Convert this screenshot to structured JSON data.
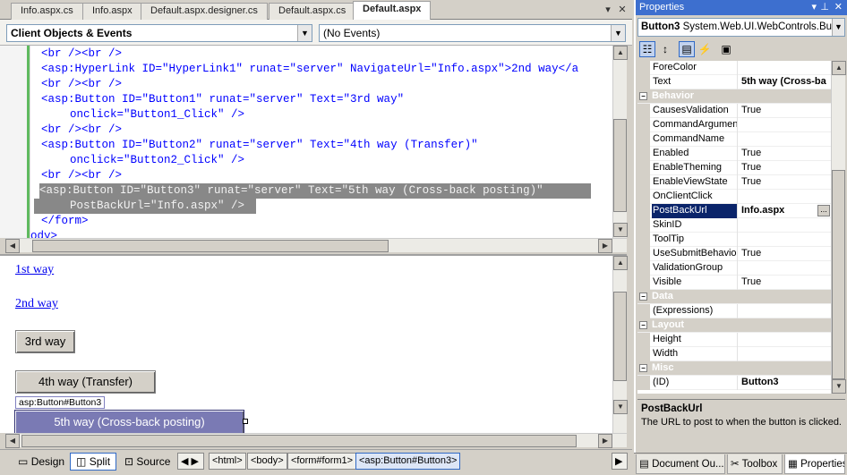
{
  "tabs": [
    {
      "label": "Info.aspx.cs"
    },
    {
      "label": "Info.aspx"
    },
    {
      "label": "Default.aspx.designer.cs"
    },
    {
      "label": "Default.aspx.cs"
    },
    {
      "label": "Default.aspx",
      "active": true
    }
  ],
  "dropdowns": {
    "objects": "Client Objects & Events",
    "events": "(No Events)"
  },
  "code": {
    "l1": "<br /><br />",
    "l2": "<asp:HyperLink ID=\"HyperLink1\" runat=\"server\" NavigateUrl=\"Info.aspx\">2nd way</a",
    "l3": "<br /><br />",
    "l4": "<asp:Button ID=\"Button1\" runat=\"server\" Text=\"3rd way\"",
    "l5": "onclick=\"Button1_Click\" />",
    "l6": "<br /><br />",
    "l7": "<asp:Button ID=\"Button2\" runat=\"server\" Text=\"4th way (Transfer)\"",
    "l8": "onclick=\"Button2_Click\" />",
    "l9": "<br /><br />",
    "l10": "<asp:Button ID=\"Button3\" runat=\"server\" Text=\"5th way (Cross-back posting)\"",
    "l11": "PostBackUrl=\"Info.aspx\" />",
    "l12": "</form>",
    "l13": "ody>"
  },
  "design": {
    "link1": "1st way",
    "link2": "2nd way",
    "btn3": "3rd way",
    "btn4": "4th way (Transfer)",
    "tag": "asp:Button#Button3",
    "btn5": "5th way (Cross-back posting)"
  },
  "bottom": {
    "views": {
      "design": "Design",
      "split": "Split",
      "source": "Source"
    },
    "breadcrumbs": [
      "<html>",
      "<body>",
      "<form#form1>",
      "<asp:Button#Button3>"
    ]
  },
  "properties": {
    "title": "Properties",
    "object": "Button3",
    "object_type": "System.Web.UI.WebControls.Butto",
    "rows": [
      {
        "name": "ForeColor",
        "value": ""
      },
      {
        "name": "Text",
        "value": "5th way (Cross-ba",
        "bold": true
      },
      {
        "category": "Behavior"
      },
      {
        "name": "CausesValidation",
        "value": "True"
      },
      {
        "name": "CommandArgument",
        "value": ""
      },
      {
        "name": "CommandName",
        "value": ""
      },
      {
        "name": "Enabled",
        "value": "True"
      },
      {
        "name": "EnableTheming",
        "value": "True"
      },
      {
        "name": "EnableViewState",
        "value": "True"
      },
      {
        "name": "OnClientClick",
        "value": ""
      },
      {
        "name": "PostBackUrl",
        "value": "Info.aspx",
        "bold": true,
        "selected": true
      },
      {
        "name": "SkinID",
        "value": ""
      },
      {
        "name": "ToolTip",
        "value": ""
      },
      {
        "name": "UseSubmitBehavior",
        "value": "True"
      },
      {
        "name": "ValidationGroup",
        "value": ""
      },
      {
        "name": "Visible",
        "value": "True"
      },
      {
        "category": "Data"
      },
      {
        "name": "(Expressions)",
        "value": ""
      },
      {
        "category": "Layout"
      },
      {
        "name": "Height",
        "value": ""
      },
      {
        "name": "Width",
        "value": ""
      },
      {
        "category": "Misc"
      },
      {
        "name": "(ID)",
        "value": "Button3",
        "bold": true
      }
    ],
    "desc_title": "PostBackUrl",
    "desc_text": "The URL to post to when the button is clicked.",
    "bottom_tabs": [
      "Document Ou...",
      "Toolbox",
      "Properties"
    ]
  }
}
